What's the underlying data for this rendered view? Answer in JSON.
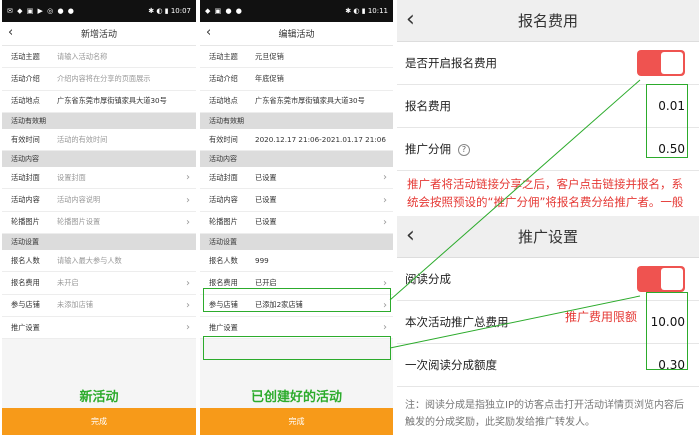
{
  "phone_new": {
    "status_right": "10:07",
    "title": "新增活动",
    "rows": [
      {
        "type": "row",
        "label": "活动主题",
        "value": "请输入活动名称",
        "ph": true,
        "chev": false
      },
      {
        "type": "row",
        "label": "活动介绍",
        "value": "介绍内容将在分享的页面展示",
        "ph": true,
        "chev": false
      },
      {
        "type": "row",
        "label": "活动地点",
        "value": "广东省东莞市厚街镇家具大道30号",
        "ph": false,
        "chev": false
      },
      {
        "type": "section",
        "label": "活动有效期"
      },
      {
        "type": "row",
        "label": "有效时间",
        "value": "活动的有效时间",
        "ph": true,
        "chev": false
      },
      {
        "type": "section",
        "label": "活动内容"
      },
      {
        "type": "row",
        "label": "活动封面",
        "value": "设置封面",
        "ph": true,
        "chev": true
      },
      {
        "type": "row",
        "label": "活动内容",
        "value": "活动内容说明",
        "ph": true,
        "chev": true
      },
      {
        "type": "row",
        "label": "轮播图片",
        "value": "轮播图片设置",
        "ph": true,
        "chev": true
      },
      {
        "type": "section",
        "label": "活动设置"
      },
      {
        "type": "row",
        "label": "报名人数",
        "value": "请输入最大参与人数",
        "ph": true,
        "chev": false
      },
      {
        "type": "row",
        "label": "报名费用",
        "value": "未开启",
        "ph": true,
        "chev": true
      },
      {
        "type": "row",
        "label": "参与店铺",
        "value": "未添加店铺",
        "ph": true,
        "chev": true
      },
      {
        "type": "row",
        "label": "推广设置",
        "value": "",
        "ph": true,
        "chev": true
      }
    ],
    "caption": "新活动",
    "done_label": "完成"
  },
  "phone_edit": {
    "status_right": "10:11",
    "title": "编辑活动",
    "rows": [
      {
        "type": "row",
        "label": "活动主题",
        "value": "元旦促销",
        "ph": false,
        "chev": false
      },
      {
        "type": "row",
        "label": "活动介绍",
        "value": "年底促销",
        "ph": false,
        "chev": false
      },
      {
        "type": "row",
        "label": "活动地点",
        "value": "广东省东莞市厚街镇家具大道30号",
        "ph": false,
        "chev": false
      },
      {
        "type": "section",
        "label": "活动有效期"
      },
      {
        "type": "row",
        "label": "有效时间",
        "value": "2020.12.17 21:06-2021.01.17 21:06",
        "ph": false,
        "chev": false
      },
      {
        "type": "section",
        "label": "活动内容"
      },
      {
        "type": "row",
        "label": "活动封面",
        "value": "已设置",
        "ph": false,
        "chev": true
      },
      {
        "type": "row",
        "label": "活动内容",
        "value": "已设置",
        "ph": false,
        "chev": true
      },
      {
        "type": "row",
        "label": "轮播图片",
        "value": "已设置",
        "ph": false,
        "chev": true
      },
      {
        "type": "section",
        "label": "活动设置"
      },
      {
        "type": "row",
        "label": "报名人数",
        "value": "999",
        "ph": false,
        "chev": false
      },
      {
        "type": "row",
        "label": "报名费用",
        "value": "已开启",
        "ph": false,
        "chev": true
      },
      {
        "type": "row",
        "label": "参与店铺",
        "value": "已添加2家店铺",
        "ph": false,
        "chev": true
      },
      {
        "type": "row",
        "label": "推广设置",
        "value": "",
        "ph": false,
        "chev": true
      }
    ],
    "caption": "已创建好的活动",
    "done_label": "完成"
  },
  "fee_panel": {
    "title": "报名费用",
    "enable_label": "是否开启报名费用",
    "enabled": true,
    "fee_label": "报名费用",
    "fee_value": "0.01",
    "commission_label": "推广分佣",
    "commission_help": "?",
    "commission_value": "0.50",
    "note": "推广者将活动链接分享之后，客户点击链接并报名，系统会按照预设的“推广分佣”将报名费分给推广者。一般情况下，报名费用大于推广分佣"
  },
  "promo_panel": {
    "title": "推广设置",
    "read_share_label": "阅读分成",
    "read_share_enabled": true,
    "total_label": "本次活动推广总费用",
    "limit_note": "推广费用限额",
    "total_value": "10.00",
    "per_label": "一次阅读分成额度",
    "per_value": "0.30",
    "footnote": "注：阅读分成是指独立IP的访客点击打开活动详情页浏览内容后触发的分成奖励，此奖励发给推广转发人。"
  },
  "colors": {
    "accent_green": "#2cab2c",
    "button_orange": "#f79a19",
    "toggle_red": "#ef5350",
    "note_red": "#e53935"
  }
}
